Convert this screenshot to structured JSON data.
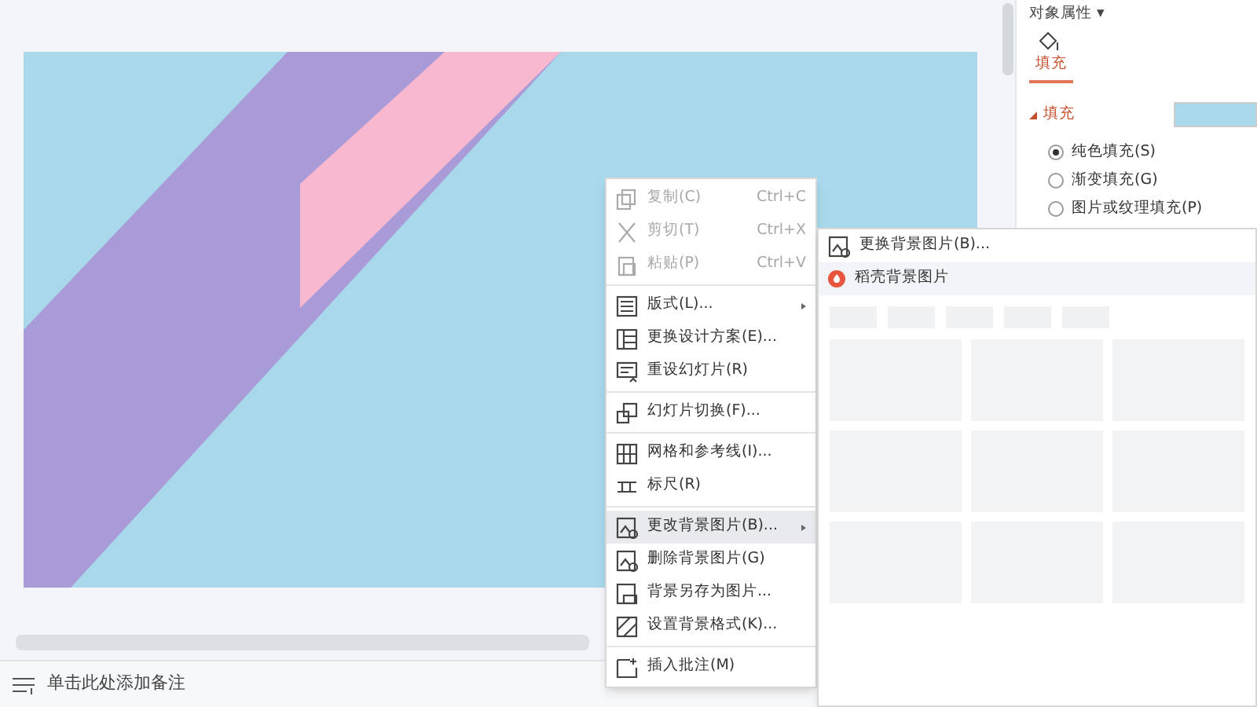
{
  "context_menu": {
    "groups": [
      [
        {
          "label": "复制(C)",
          "shortcut": "Ctrl+C",
          "kind": "copy",
          "disabled": true,
          "selected": false,
          "submenu": false
        },
        {
          "label": "剪切(T)",
          "shortcut": "Ctrl+X",
          "kind": "cut",
          "disabled": true,
          "selected": false,
          "submenu": false
        },
        {
          "label": "粘贴(P)",
          "shortcut": "Ctrl+V",
          "kind": "paste",
          "disabled": true,
          "selected": false,
          "submenu": false
        }
      ],
      [
        {
          "label": "版式(L)...",
          "kind": "layout",
          "disabled": false,
          "selected": false,
          "submenu": true
        },
        {
          "label": "更换设计方案(E)...",
          "kind": "design",
          "disabled": false,
          "selected": false,
          "submenu": false
        },
        {
          "label": "重设幻灯片(R)",
          "kind": "reset",
          "disabled": false,
          "selected": false,
          "submenu": false
        }
      ],
      [
        {
          "label": "幻灯片切换(F)...",
          "kind": "transition",
          "disabled": false,
          "selected": false,
          "submenu": false
        }
      ],
      [
        {
          "label": "网格和参考线(I)...",
          "kind": "grid",
          "disabled": false,
          "selected": false,
          "submenu": false
        },
        {
          "label": "标尺(R)",
          "kind": "ruler",
          "disabled": false,
          "selected": false,
          "submenu": false
        }
      ],
      [
        {
          "label": "更改背景图片(B)...",
          "kind": "image",
          "disabled": false,
          "selected": true,
          "submenu": true
        },
        {
          "label": "删除背景图片(G)",
          "kind": "image",
          "disabled": false,
          "selected": false,
          "submenu": false
        },
        {
          "label": "背景另存为图片...",
          "kind": "save",
          "disabled": false,
          "selected": false,
          "submenu": false
        },
        {
          "label": "设置背景格式(K)...",
          "kind": "format",
          "disabled": false,
          "selected": false,
          "submenu": false
        }
      ],
      [
        {
          "label": "插入批注(M)",
          "kind": "comment",
          "disabled": false,
          "selected": false,
          "submenu": false
        }
      ]
    ]
  },
  "submenu": {
    "items": [
      {
        "label": "更换背景图片(B)...",
        "kind": "image",
        "selected": false
      },
      {
        "label": "稻壳背景图片",
        "kind": "docer",
        "selected": true
      }
    ]
  },
  "properties_panel": {
    "title": "对象属性 ▾",
    "tabs": [
      {
        "label": "填充",
        "selected": true
      }
    ],
    "section": {
      "label": "填充",
      "expanded": true
    },
    "options": [
      {
        "label": "纯色填充(S)",
        "selected": true
      },
      {
        "label": "渐变填充(G)",
        "selected": false
      },
      {
        "label": "图片或纹理填充(P)",
        "selected": false
      }
    ]
  },
  "notes": {
    "placeholder": "单击此处添加备注"
  }
}
